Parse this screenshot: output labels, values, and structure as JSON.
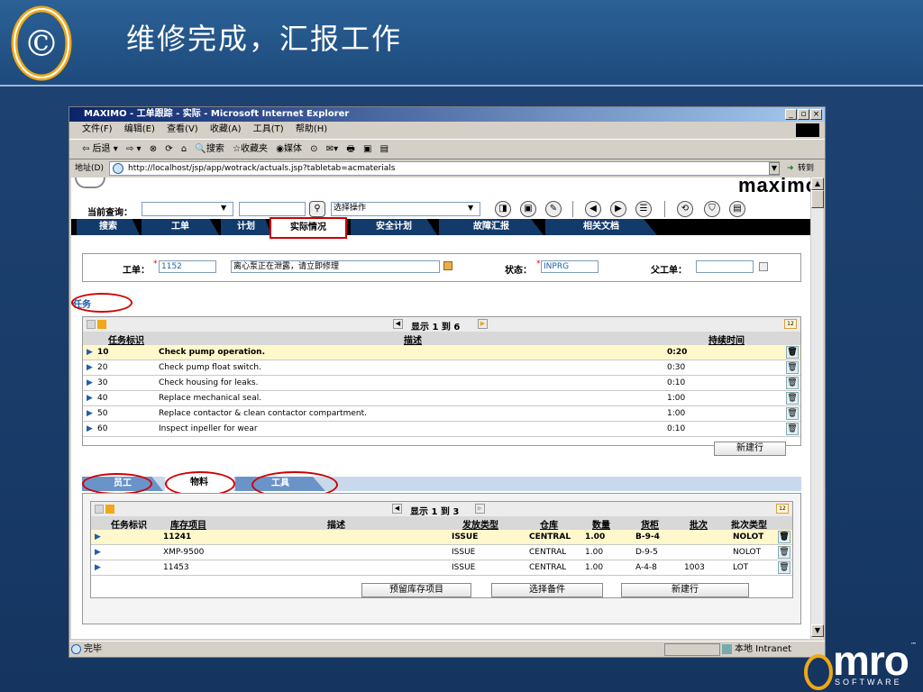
{
  "slide": {
    "title": "维修完成，汇报工作",
    "logo_glyph": "©",
    "brand_word": "mro",
    "brand_sub": "SOFTWARE",
    "brand_r": "™"
  },
  "browser": {
    "title": "MAXIMO - 工单跟踪 - 实际 - Microsoft Internet Explorer",
    "win_buttons": [
      "_",
      "▫",
      "×"
    ],
    "menu": [
      "文件(F)",
      "编辑(E)",
      "查看(V)",
      "收藏(A)",
      "工具(T)",
      "帮助(H)"
    ],
    "toolbar": [
      "⇦ 后退 ▾",
      "⇨ ▾",
      "⊗",
      "⟳",
      "⌂",
      "🔍搜索",
      "☆收藏夹",
      "◉媒体",
      "⊙",
      "✉▾",
      "🖶",
      "▣",
      "▤"
    ],
    "address_label": "地址(D)",
    "url": "http://localhost/jsp/app/wotrack/actuals.jsp?tabletab=acmaterials",
    "go_label": "转到",
    "status_text": "完毕",
    "zone_text": "本地 Intranet"
  },
  "maximo": {
    "brand": "maximo",
    "query_label": "当前查询：",
    "action_select": "选择操作",
    "tabs": [
      {
        "label": "搜索"
      },
      {
        "label": "工单"
      },
      {
        "label": "计划"
      },
      {
        "label": "实际情况"
      },
      {
        "label": "安全计划"
      },
      {
        "label": "故障汇报"
      },
      {
        "label": "相关文档"
      }
    ],
    "wo_label": "工单：",
    "wo_number": "1152",
    "wo_desc": "离心泵正在泄露，请立即修理",
    "status_label": "状态：",
    "status_value": "INPRG",
    "parent_label": "父工单：",
    "required_mark": "*"
  },
  "tasks": {
    "section_label": "任务",
    "pager": "显示 1 到 6",
    "columns": [
      "任务标识",
      "描述",
      "持续时间"
    ],
    "rows": [
      {
        "id": "10",
        "desc": "Check pump operation.",
        "dur": "0:20"
      },
      {
        "id": "20",
        "desc": "Check pump float switch.",
        "dur": "0:30"
      },
      {
        "id": "30",
        "desc": "Check housing for leaks.",
        "dur": "0:10"
      },
      {
        "id": "40",
        "desc": "Replace mechanical seal.",
        "dur": "1:00"
      },
      {
        "id": "50",
        "desc": "Replace contactor & clean contactor compartment.",
        "dur": "1:00"
      },
      {
        "id": "60",
        "desc": "Inspect inpeller for wear",
        "dur": "0:10"
      }
    ],
    "new_row": "新建行"
  },
  "subtabs": [
    "员工",
    "物料",
    "工具"
  ],
  "materials": {
    "pager": "显示 1 到 3",
    "columns": [
      "任务标识",
      "库存项目",
      "描述",
      "发放类型",
      "仓库",
      "数量",
      "货柜",
      "批次",
      "批次类型"
    ],
    "rows": [
      {
        "task": "",
        "item": "11241",
        "desc": "",
        "type": "ISSUE",
        "store": "CENTRAL",
        "qty": "1.00",
        "bin": "B-9-4",
        "lot": "",
        "lottype": "NOLOT"
      },
      {
        "task": "",
        "item": "XMP-9500",
        "desc": "",
        "type": "ISSUE",
        "store": "CENTRAL",
        "qty": "1.00",
        "bin": "D-9-5",
        "lot": "",
        "lottype": "NOLOT"
      },
      {
        "task": "",
        "item": "11453",
        "desc": "",
        "type": "ISSUE",
        "store": "CENTRAL",
        "qty": "1.00",
        "bin": "A-4-8",
        "lot": "1003",
        "lottype": "LOT"
      }
    ],
    "buttons": [
      "预留库存项目",
      "选择备件",
      "新建行"
    ]
  }
}
